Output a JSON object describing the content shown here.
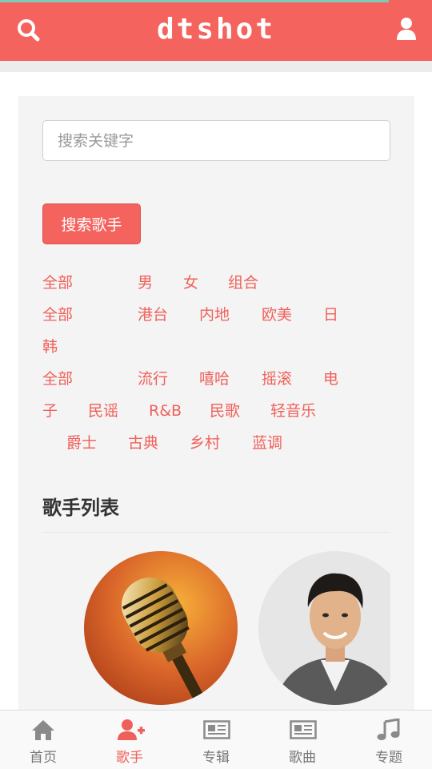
{
  "header": {
    "logo": "dtshot",
    "search_icon": "search-icon",
    "user_icon": "user-icon"
  },
  "search": {
    "placeholder": "搜索关键字",
    "value": "",
    "button_label": "搜索歌手"
  },
  "filters": {
    "gender": [
      "全部",
      "男",
      "女",
      "组合"
    ],
    "region": [
      "全部",
      "港台",
      "内地",
      "欧美",
      "日",
      "韩"
    ],
    "genre": [
      "全部",
      "流行",
      "嘻哈",
      "摇滚",
      "电",
      "子",
      "民谣",
      "R&B",
      "民歌",
      "轻音乐",
      "爵士",
      "古典",
      "乡村",
      "蓝调"
    ]
  },
  "singer_list": {
    "title": "歌手列表",
    "items": [
      {
        "image": "microphone-photo"
      },
      {
        "image": "singer-portrait-photo"
      }
    ]
  },
  "tabbar": {
    "items": [
      {
        "label": "首页",
        "icon": "home-icon",
        "active": false
      },
      {
        "label": "歌手",
        "icon": "add-user-icon",
        "active": true
      },
      {
        "label": "专辑",
        "icon": "newspaper-icon",
        "active": false
      },
      {
        "label": "歌曲",
        "icon": "newspaper-icon",
        "active": false
      },
      {
        "label": "专题",
        "icon": "music-note-icon",
        "active": false
      }
    ]
  },
  "colors": {
    "accent": "#f4635d",
    "link": "#f0605a",
    "top_strip": "#7fc9b5"
  }
}
